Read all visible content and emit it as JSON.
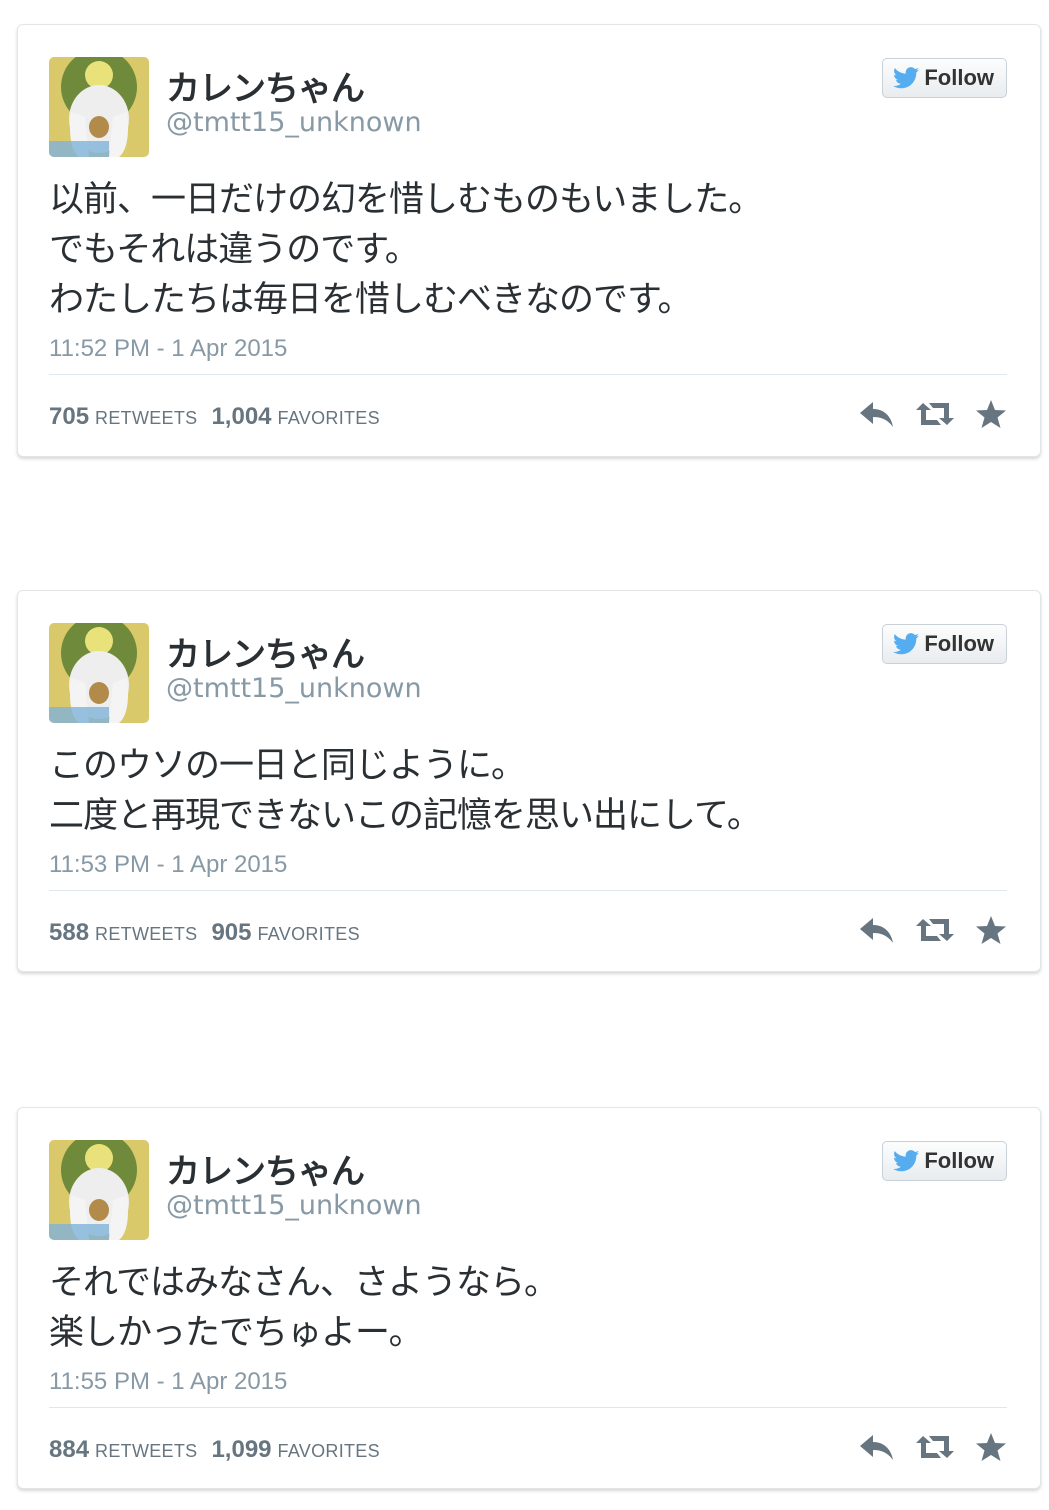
{
  "tweets": [
    {
      "display_name": "カレンちゃん",
      "screen_name": "@tmtt15_unknown",
      "follow_label": "Follow",
      "lines": [
        "以前、一日だけの幻を惜しむものもいました。",
        "でもそれは違うのです。",
        "わたしたちは毎日を惜しむべきなのです。"
      ],
      "timestamp": "11:52 PM - 1 Apr 2015",
      "retweets_count": "705",
      "retweets_label": "RETWEETS",
      "favorites_count": "1,004",
      "favorites_label": "FAVORITES"
    },
    {
      "display_name": "カレンちゃん",
      "screen_name": "@tmtt15_unknown",
      "follow_label": "Follow",
      "lines": [
        "このウソの一日と同じように。",
        "二度と再現できないこの記憶を思い出にして。"
      ],
      "timestamp": "11:53 PM - 1 Apr 2015",
      "retweets_count": "588",
      "retweets_label": "RETWEETS",
      "favorites_count": "905",
      "favorites_label": "FAVORITES"
    },
    {
      "display_name": "カレンちゃん",
      "screen_name": "@tmtt15_unknown",
      "follow_label": "Follow",
      "lines": [
        "それではみなさん、さようなら。",
        "楽しかったでちゅよー。"
      ],
      "timestamp": "11:55 PM - 1 Apr 2015",
      "retweets_count": "884",
      "retweets_label": "RETWEETS",
      "favorites_count": "1,099",
      "favorites_label": "FAVORITES"
    }
  ],
  "icons": {
    "follow": "twitter-bird-icon",
    "reply": "reply-icon",
    "retweet": "retweet-icon",
    "favorite": "star-icon"
  },
  "colors": {
    "twitter_blue": "#55acee",
    "meta_gray": "#8899a6",
    "action_gray": "#66757f"
  }
}
